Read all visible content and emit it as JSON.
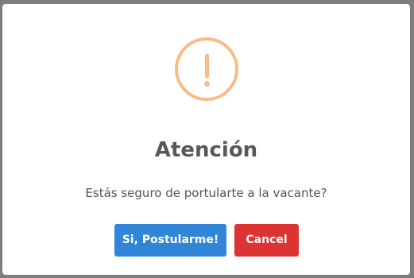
{
  "dialog": {
    "title": "Atención",
    "message": "Estás seguro de portularte a la vacante?",
    "confirm_label": "Si, Postularme!",
    "cancel_label": "Cancel",
    "icon": "warning-icon"
  },
  "colors": {
    "overlay": "#7d7d7d",
    "dialog_background": "#ffffff",
    "warning_icon": "#f8bb86",
    "title_text": "#575757",
    "message_text": "#545454",
    "confirm_button": "#3085d6",
    "cancel_button": "#dd3333"
  }
}
